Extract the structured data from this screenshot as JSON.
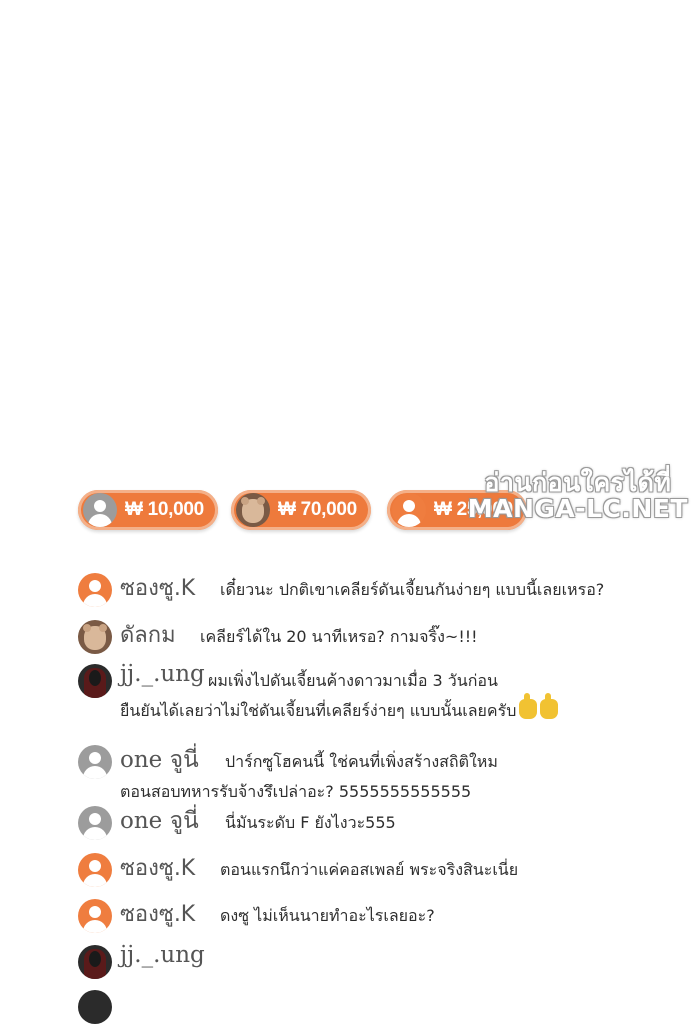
{
  "watermark": {
    "line1": "อ่านก่อนใครได้ที่",
    "line2": "MANGA-LC.NET"
  },
  "donations": [
    {
      "amount": "₩ 10,000",
      "avatar": "gray-person"
    },
    {
      "amount": "₩ 70,000",
      "avatar": "bear-photo"
    },
    {
      "amount": "₩ 25,000",
      "avatar": "orange-person"
    }
  ],
  "comments": [
    {
      "name": "ซองซู.K",
      "avatar": "orange-person",
      "lines": [
        "เดี๋ยวนะ ปกติเขาเคลียร์ดันเจี้ยนกันง่ายๆ แบบนี้เลยเหรอ?"
      ]
    },
    {
      "name": "ดัลกม",
      "avatar": "bear-photo",
      "lines": [
        "เคลียร์ได้ใน 20 นาทีเหรอ? กามจริ๊ง~!!!"
      ]
    },
    {
      "name": "jj._.ung",
      "avatar": "dark-photo",
      "lines": [
        "ผมเพิ่งไปดันเจี้ยนค้างดาวมาเมื่อ 3 วันก่อน",
        "ยืนยันได้เลยว่าไม่ใช่ดันเจี้ยนที่เคลียร์ง่ายๆ แบบนั้นเลยครับ"
      ]
    },
    {
      "name": "one จูนี่",
      "avatar": "gray-person",
      "lines": [
        "ปาร์กซูโฮคนนี้ ใช่คนที่เพิ่งสร้างสถิติใหม",
        "ตอนสอบทหารรับจ้างรึเปล่าอะ? 5555555555555"
      ]
    },
    {
      "name": "one จูนี่",
      "avatar": "gray-person",
      "lines": [
        "นี่มันระดับ F ยังไงวะ555"
      ]
    },
    {
      "name": "ซองซู.K",
      "avatar": "orange-person",
      "lines": [
        "ตอนแรกนึกว่าแค่คอสเพลย์ พระจริงสินะเนี่ย"
      ]
    },
    {
      "name": "ซองซู.K",
      "avatar": "orange-person",
      "lines": [
        "ดงซู ไม่เห็นนายทำอะไรเลยอะ?"
      ]
    },
    {
      "name": "jj._.ung",
      "avatar": "dark-photo",
      "lines": []
    }
  ],
  "colors": {
    "accent": "#ee7a3c",
    "gray_avatar": "#9c9c9c"
  },
  "icons": {
    "thumbs_up": "thumbs-up-emoji",
    "default_avatar": "person-icon"
  }
}
